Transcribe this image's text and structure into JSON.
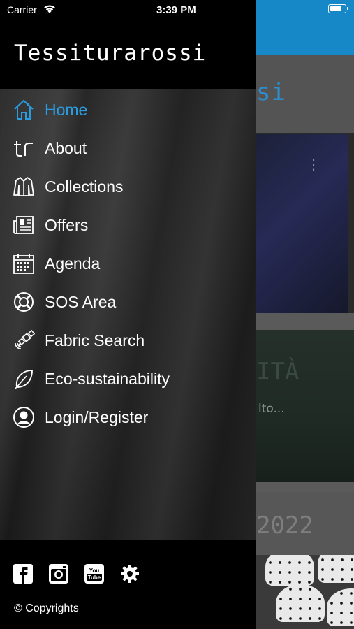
{
  "status_bar": {
    "carrier": "Carrier",
    "time": "3:39 PM"
  },
  "drawer": {
    "title": "Tessiturarossi",
    "menu": [
      {
        "label": "Home",
        "icon": "home-icon",
        "active": true
      },
      {
        "label": "About",
        "icon": "tr-logo-icon",
        "active": false
      },
      {
        "label": "Collections",
        "icon": "jacket-icon",
        "active": false
      },
      {
        "label": "Offers",
        "icon": "newspaper-icon",
        "active": false
      },
      {
        "label": "Agenda",
        "icon": "calendar-icon",
        "active": false
      },
      {
        "label": "SOS Area",
        "icon": "lifebuoy-icon",
        "active": false
      },
      {
        "label": "Fabric Search",
        "icon": "satellite-icon",
        "active": false
      },
      {
        "label": "Eco-sustainability",
        "icon": "leaf-icon",
        "active": false
      },
      {
        "label": "Login/Register",
        "icon": "user-icon",
        "active": false
      }
    ],
    "footer": {
      "social": [
        "facebook-icon",
        "instagram-icon",
        "youtube-icon",
        "settings-gear-icon"
      ],
      "youtube_text_1": "You",
      "youtube_text_2": "Tube",
      "copyright": "© Copyrights"
    }
  },
  "background_app": {
    "title_fragment": "si",
    "card2_title_fragment": "ITÀ",
    "card2_subtitle_fragment": "lto...",
    "card3_text_fragment": "2022"
  },
  "colors": {
    "accent": "#2a9ce0",
    "topbar": "#1688c7",
    "drawer_bg": "#000000"
  }
}
